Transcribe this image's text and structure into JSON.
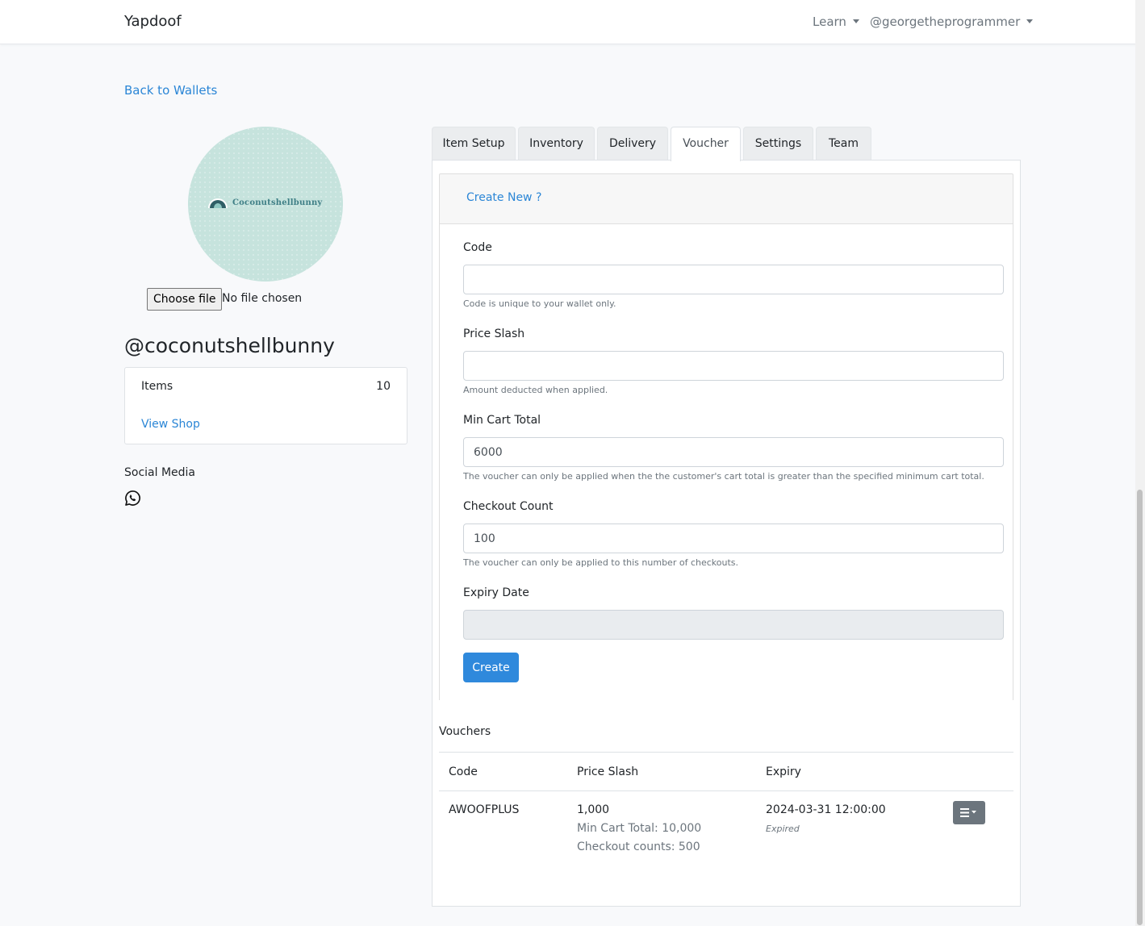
{
  "navbar": {
    "brand": "Yapdoof",
    "learn_label": "Learn",
    "user_label": "@georgetheprogrammer"
  },
  "back_link": "Back to Wallets",
  "profile": {
    "avatar_text": "Coconutshellbunny",
    "file_button": "Choose file",
    "file_status": "No file chosen",
    "handle": "@coconutshellbunny",
    "items_label": "Items",
    "items_value": "10",
    "view_shop": "View Shop",
    "social_title": "Social Media",
    "social_icons": [
      "whatsapp-icon"
    ]
  },
  "tabs": [
    {
      "label": "Item Setup",
      "active": false
    },
    {
      "label": "Inventory",
      "active": false
    },
    {
      "label": "Delivery",
      "active": false
    },
    {
      "label": "Voucher",
      "active": true
    },
    {
      "label": "Settings",
      "active": false
    },
    {
      "label": "Team",
      "active": false
    }
  ],
  "voucher_form": {
    "create_new": "Create New ?",
    "code": {
      "label": "Code",
      "value": "",
      "help": "Code is unique to your wallet only."
    },
    "price_slash": {
      "label": "Price Slash",
      "value": "",
      "help": "Amount deducted when applied."
    },
    "min_cart_total": {
      "label": "Min Cart Total",
      "value": "6000",
      "help": "The voucher can only be applied when the the customer's cart total is greater than the specified minimum cart total."
    },
    "checkout_count": {
      "label": "Checkout Count",
      "value": "100",
      "help": "The voucher can only be applied to this number of checkouts."
    },
    "expiry_date": {
      "label": "Expiry Date",
      "value": ""
    },
    "create_button": "Create"
  },
  "vouchers": {
    "title": "Vouchers",
    "columns": [
      "Code",
      "Price Slash",
      "Expiry"
    ],
    "rows": [
      {
        "code": "AWOOFPLUS",
        "price_slash": "1,000",
        "min_cart_total": "Min Cart Total: 10,000",
        "checkout_counts": "Checkout counts: 500",
        "expiry": "2024-03-31 12:00:00",
        "status": "Expired",
        "action_icon": "menu-dropdown-icon"
      }
    ]
  },
  "colors": {
    "link": "#2b86d6",
    "primary_button": "#2f89dc",
    "secondary_button": "#6c757d",
    "avatar_bg": "#c6e3dd"
  }
}
